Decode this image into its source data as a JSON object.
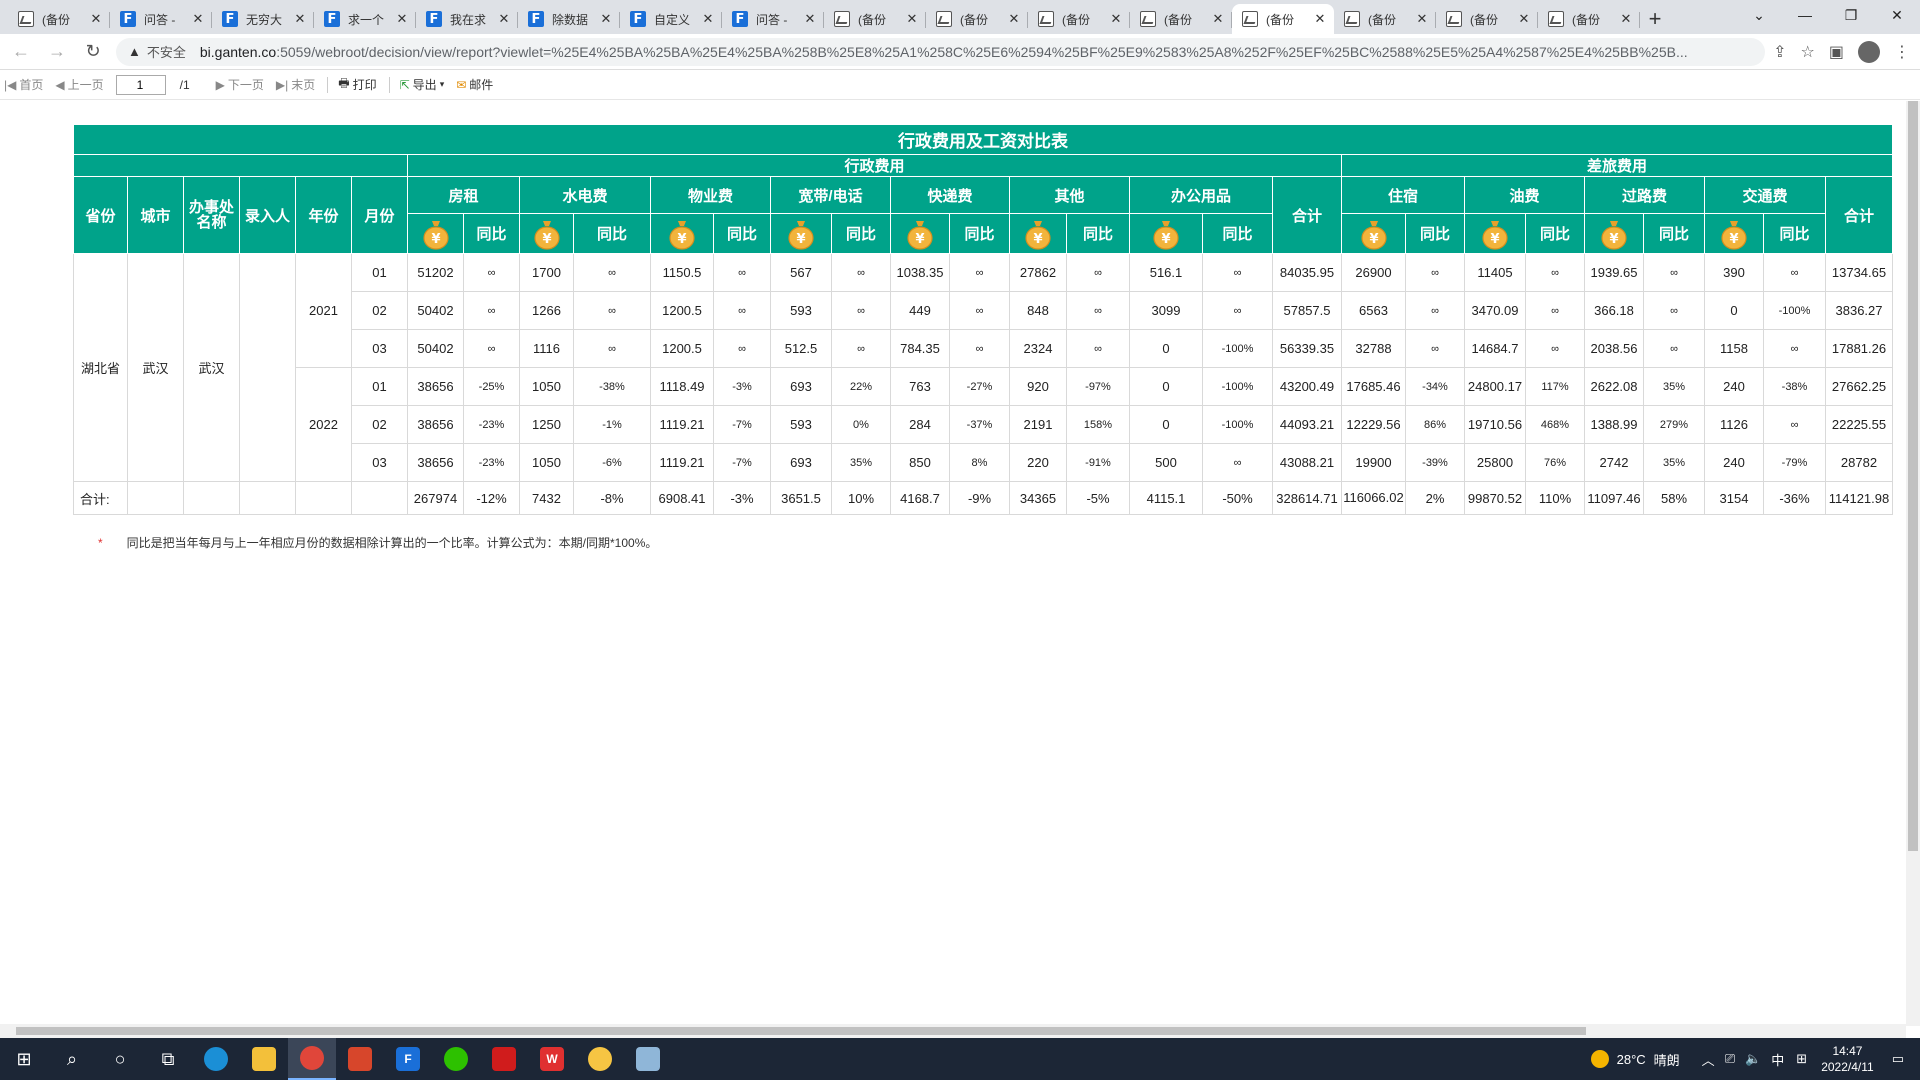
{
  "browser": {
    "tabs": [
      {
        "icon": "image",
        "label": "(备份",
        "active": false
      },
      {
        "icon": "fr",
        "label": "问答 -",
        "active": false
      },
      {
        "icon": "fr",
        "label": "无穷大",
        "active": false
      },
      {
        "icon": "fr",
        "label": "求一个",
        "active": false
      },
      {
        "icon": "fr",
        "label": "我在求",
        "active": false
      },
      {
        "icon": "fr",
        "label": "除数据",
        "active": false
      },
      {
        "icon": "fr",
        "label": "自定义",
        "active": false
      },
      {
        "icon": "fr",
        "label": "问答 -",
        "active": false
      },
      {
        "icon": "image",
        "label": "(备份",
        "active": false
      },
      {
        "icon": "image",
        "label": "(备份",
        "active": false
      },
      {
        "icon": "image",
        "label": "(备份",
        "active": false
      },
      {
        "icon": "image",
        "label": "(备份",
        "active": false
      },
      {
        "icon": "image",
        "label": "(备份",
        "active": true
      },
      {
        "icon": "image",
        "label": "(备份",
        "active": false
      },
      {
        "icon": "image",
        "label": "(备份",
        "active": false
      },
      {
        "icon": "image",
        "label": "(备份",
        "active": false
      }
    ],
    "security_label": "不安全",
    "url_host": "bi.ganten.co",
    "url_path": ":5059/webroot/decision/view/report?viewlet=%25E4%25BA%25BA%25E4%25BA%258B%25E8%25A1%258C%25E6%2594%25BF%25E9%2583%25A8%252F%25EF%25BC%2588%25E5%25A4%2587%25E4%25BB%25B..."
  },
  "toolbar": {
    "first": "首页",
    "prev": "上一页",
    "page_value": "1",
    "page_total": "/1",
    "next": "下一页",
    "last": "末页",
    "print": "打印",
    "export": "导出",
    "mail": "邮件"
  },
  "report": {
    "title": "行政费用及工资对比表",
    "group_admin": "行政费用",
    "group_travel": "差旅费用",
    "col_province": "省份",
    "col_city": "城市",
    "col_office": "办事处名称",
    "col_entry": "录入人",
    "col_year": "年份",
    "col_month": "月份",
    "admin_categories": [
      "房租",
      "水电费",
      "物业费",
      "宽带/电话",
      "快递费",
      "其他",
      "办公用品"
    ],
    "travel_categories": [
      "住宿",
      "油费",
      "过路费",
      "交通费"
    ],
    "yoy_label": "同比",
    "total_label": "合计",
    "province": "湖北省",
    "city": "武汉",
    "office": "武汉",
    "years": [
      "2021",
      "2022"
    ],
    "rows": [
      {
        "month": "01",
        "cells": [
          "51202",
          "∞",
          "1700",
          "∞",
          "1150.5",
          "∞",
          "567",
          "∞",
          "1038.35",
          "∞",
          "27862",
          "∞",
          "516.1",
          "∞",
          "84035.95",
          "26900",
          "∞",
          "11405",
          "∞",
          "1939.65",
          "∞",
          "390",
          "∞",
          "13734.65"
        ]
      },
      {
        "month": "02",
        "cells": [
          "50402",
          "∞",
          "1266",
          "∞",
          "1200.5",
          "∞",
          "593",
          "∞",
          "449",
          "∞",
          "848",
          "∞",
          "3099",
          "∞",
          "57857.5",
          "6563",
          "∞",
          "3470.09",
          "∞",
          "366.18",
          "∞",
          "0",
          "-100%",
          "3836.27"
        ]
      },
      {
        "month": "03",
        "cells": [
          "50402",
          "∞",
          "1116",
          "∞",
          "1200.5",
          "∞",
          "512.5",
          "∞",
          "784.35",
          "∞",
          "2324",
          "∞",
          "0",
          "-100%",
          "56339.35",
          "32788",
          "∞",
          "14684.7",
          "∞",
          "2038.56",
          "∞",
          "1158",
          "∞",
          "17881.26"
        ]
      },
      {
        "month": "01",
        "cells": [
          "38656",
          "-25%",
          "1050",
          "-38%",
          "1118.49",
          "-3%",
          "693",
          "22%",
          "763",
          "-27%",
          "920",
          "-97%",
          "0",
          "-100%",
          "43200.49",
          "17685.46",
          "-34%",
          "24800.17",
          "117%",
          "2622.08",
          "35%",
          "240",
          "-38%",
          "27662.25"
        ]
      },
      {
        "month": "02",
        "cells": [
          "38656",
          "-23%",
          "1250",
          "-1%",
          "1119.21",
          "-7%",
          "593",
          "0%",
          "284",
          "-37%",
          "2191",
          "158%",
          "0",
          "-100%",
          "44093.21",
          "12229.56",
          "86%",
          "19710.56",
          "468%",
          "1388.99",
          "279%",
          "1126",
          "∞",
          "22225.55"
        ]
      },
      {
        "month": "03",
        "cells": [
          "38656",
          "-23%",
          "1050",
          "-6%",
          "1119.21",
          "-7%",
          "693",
          "35%",
          "850",
          "8%",
          "220",
          "-91%",
          "500",
          "∞",
          "43088.21",
          "19900",
          "-39%",
          "25800",
          "76%",
          "2742",
          "35%",
          "240",
          "-79%",
          "28782"
        ]
      }
    ],
    "total_row_label": "合计:",
    "totals": [
      "267974",
      "-12%",
      "7432",
      "-8%",
      "6908.41",
      "-3%",
      "3651.5",
      "10%",
      "4168.7",
      "-9%",
      "34365",
      "-5%",
      "4115.1",
      "-50%",
      "328614.71",
      "116066.02",
      "2%",
      "99870.52",
      "110%",
      "11097.46",
      "58%",
      "3154",
      "-36%",
      "114121.98"
    ],
    "note_star": "*",
    "note": "同比是把当年每月与上一年相应月份的数据相除计算出的一个比率。计算公式为：本期/同期*100%。"
  },
  "taskbar": {
    "weather_temp": "28°C",
    "weather_desc": "晴朗",
    "ime": "中",
    "time": "14:47",
    "date": "2022/4/11"
  },
  "colors": {
    "header_bg": "#00a38a",
    "moneybag": "#f2b43c"
  }
}
